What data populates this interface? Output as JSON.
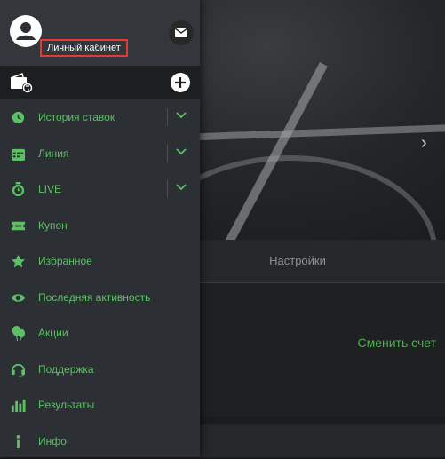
{
  "header": {
    "cabinet_label": "Личный кабинет"
  },
  "menu": [
    {
      "label": "История ставок",
      "icon": "history-icon",
      "expandable": true
    },
    {
      "label": "Линия",
      "icon": "calendar-icon",
      "expandable": true
    },
    {
      "label": "LIVE",
      "icon": "stopwatch-icon",
      "expandable": true
    },
    {
      "label": "Купон",
      "icon": "ticket-icon",
      "expandable": false
    },
    {
      "label": "Избранное",
      "icon": "star-icon",
      "expandable": false
    },
    {
      "label": "Последняя активность",
      "icon": "eye-icon",
      "expandable": false
    },
    {
      "label": "Акции",
      "icon": "balloons-icon",
      "expandable": false
    },
    {
      "label": "Поддержка",
      "icon": "headset-icon",
      "expandable": false
    },
    {
      "label": "Результаты",
      "icon": "bar-chart-icon",
      "expandable": false
    },
    {
      "label": "Инфо",
      "icon": "info-icon",
      "expandable": false
    }
  ],
  "background": {
    "tab_settings": "Настройки",
    "change_account": "Сменить счет"
  },
  "colors": {
    "accent": "#5cc065",
    "drawer": "#2c2f33",
    "highlight_border": "#e53935"
  }
}
